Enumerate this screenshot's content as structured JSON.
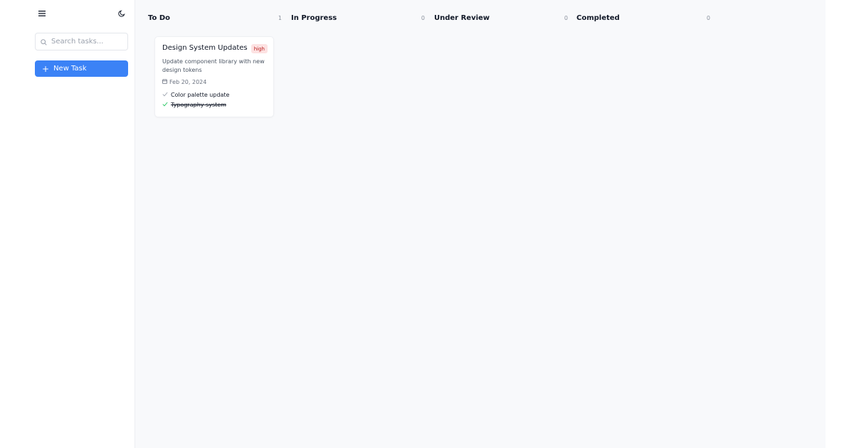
{
  "sidebar": {
    "menu_icon": "hamburger-menu-icon",
    "theme_icon": "moon-icon",
    "search": {
      "placeholder": "Search tasks...",
      "value": ""
    },
    "new_task_label": "New Task"
  },
  "board": {
    "columns": [
      {
        "title": "To Do",
        "count": "1",
        "cards": [
          {
            "title": "Design System Updates",
            "priority": "high",
            "description": "Update component library with new design tokens",
            "date": "Feb 20, 2024",
            "subtasks": [
              {
                "text": "Color palette update",
                "done": false
              },
              {
                "text": "Typography system",
                "done": true
              }
            ]
          }
        ]
      },
      {
        "title": "In Progress",
        "count": "0",
        "cards": []
      },
      {
        "title": "Under Review",
        "count": "0",
        "cards": []
      },
      {
        "title": "Completed",
        "count": "0",
        "cards": []
      }
    ]
  },
  "colors": {
    "accent": "#3b82f6",
    "priority_high_bg": "#fde2e2",
    "priority_high_text": "#b91c1c",
    "check_pending": "#9ca3af",
    "check_done": "#22c55e",
    "board_bg": "#f8f9fb"
  }
}
